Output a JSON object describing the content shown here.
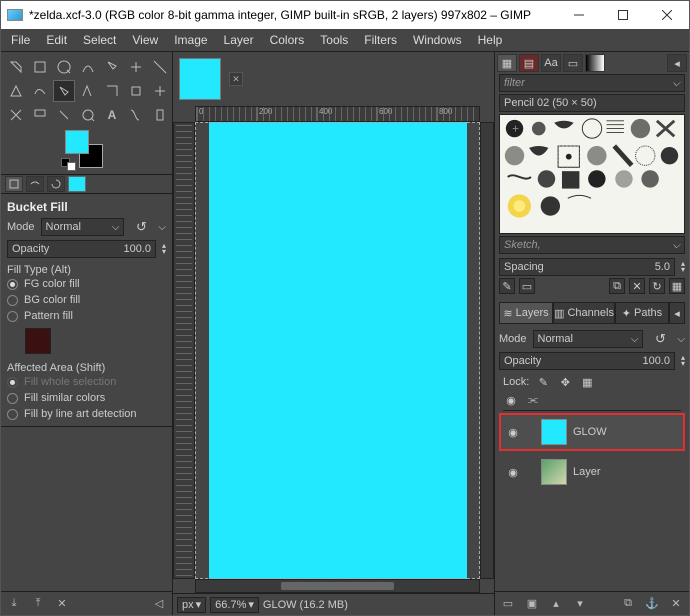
{
  "title": "*zelda.xcf-3.0 (RGB color 8-bit gamma integer, GIMP built-in sRGB, 2 layers) 997x802 – GIMP",
  "menus": [
    "File",
    "Edit",
    "Select",
    "View",
    "Image",
    "Layer",
    "Colors",
    "Tools",
    "Filters",
    "Windows",
    "Help"
  ],
  "tool_options": {
    "title": "Bucket Fill",
    "mode_label": "Mode",
    "mode_value": "Normal",
    "opacity_label": "Opacity",
    "opacity_value": "100.0",
    "fill_type_label": "Fill Type  (Alt)",
    "fill_types": [
      {
        "label": "FG color fill",
        "on": true
      },
      {
        "label": "BG color fill",
        "on": false
      },
      {
        "label": "Pattern fill",
        "on": false
      }
    ],
    "affected_label": "Affected Area  (Shift)",
    "affected": [
      {
        "label": "Fill whole selection",
        "on": true,
        "dis": true
      },
      {
        "label": "Fill similar colors",
        "on": false
      },
      {
        "label": "Fill by line art detection",
        "on": false
      }
    ]
  },
  "ruler_marks": [
    "0",
    "200",
    "400",
    "600",
    "800"
  ],
  "status": {
    "unit": "px",
    "zoom": "66.7%",
    "layer_info": "GLOW (16.2 MB)"
  },
  "right": {
    "filter_placeholder": "filter",
    "brush_name": "Pencil 02 (50 × 50)",
    "sketch_label": "Sketch,",
    "spacing_label": "Spacing",
    "spacing_value": "5.0",
    "tabs": [
      "Layers",
      "Channels",
      "Paths"
    ],
    "mode_label": "Mode",
    "mode_value": "Normal",
    "opacity_label": "Opacity",
    "opacity_value": "100.0",
    "lock_label": "Lock:",
    "layers": [
      {
        "name": "GLOW",
        "sel": true,
        "thumb": "cyan"
      },
      {
        "name": "Layer",
        "sel": false,
        "thumb": "img"
      }
    ]
  },
  "colors": {
    "canvas": "#22e9ff"
  }
}
